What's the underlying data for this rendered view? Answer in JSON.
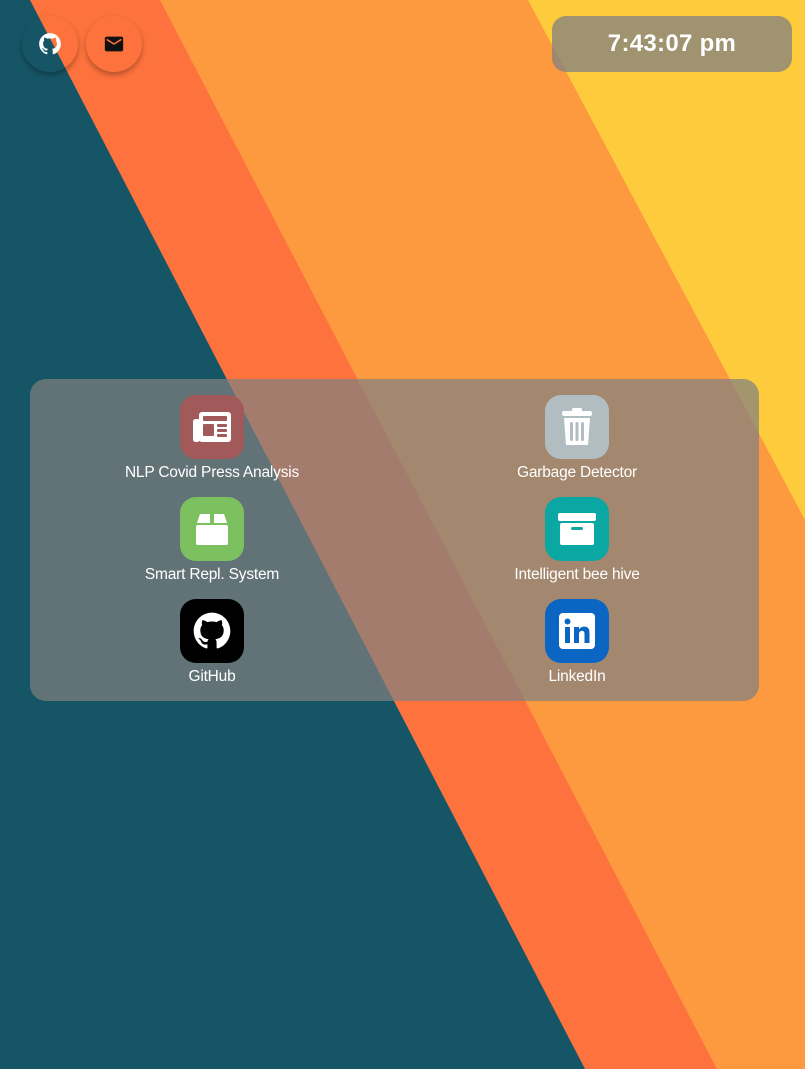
{
  "wallpaper": {
    "colors": {
      "teal": "#165566",
      "red_orange": "#fe733d",
      "orange": "#fd9a40",
      "yellow": "#fecb3d"
    }
  },
  "top_bar": {
    "buttons": [
      {
        "id": "github",
        "icon": "github-icon",
        "color": "#0a86d3"
      },
      {
        "id": "mail",
        "icon": "mail-icon",
        "color": "#e4e4e4"
      }
    ],
    "clock": {
      "time": "7:43:07 pm"
    }
  },
  "launcher": {
    "apps": [
      {
        "label": "NLP Covid Press Analysis",
        "icon": "newspaper-icon",
        "color": "#a15959"
      },
      {
        "label": "Garbage Detector",
        "icon": "trash-icon",
        "color": "#b1bdc1"
      },
      {
        "label": "Smart Repl. System",
        "icon": "package-icon",
        "color": "#7cc05f"
      },
      {
        "label": "Intelligent bee hive",
        "icon": "archive-icon",
        "color": "#0ba7a3"
      },
      {
        "label": "GitHub",
        "icon": "github-icon",
        "color": "#000000"
      },
      {
        "label": "LinkedIn",
        "icon": "linkedin-icon",
        "color": "#0a66c2"
      }
    ]
  }
}
